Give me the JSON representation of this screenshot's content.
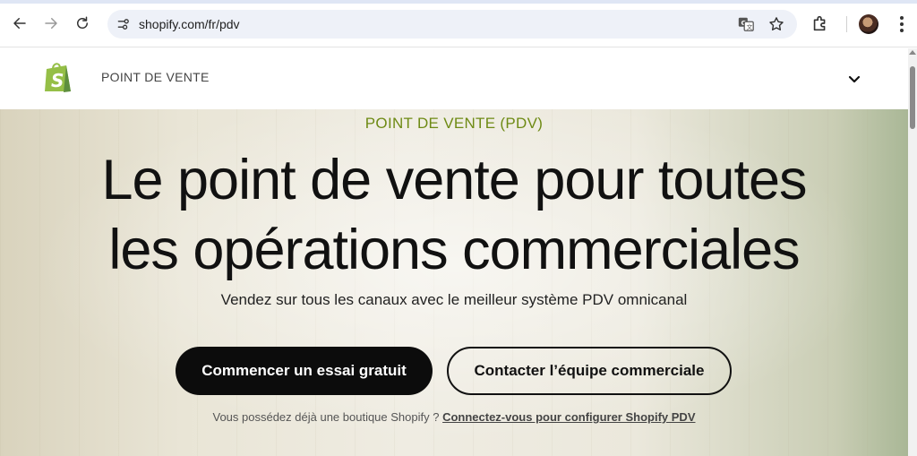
{
  "browser": {
    "url": "shopify.com/fr/pdv"
  },
  "header": {
    "title": "POINT DE VENTE"
  },
  "hero": {
    "eyebrow": "POINT DE VENTE (PDV)",
    "headline_line1": "Le point de vente pour toutes",
    "headline_line2": "les opérations commerciales",
    "subtitle": "Vendez sur tous les canaux avec le meilleur système PDV omnicanal",
    "primary_button": "Commencer un essai gratuit",
    "secondary_button": "Contacter l’équipe commerciale",
    "footnote_text": "Vous possédez déjà une boutique Shopify ? ",
    "footnote_link": "Connectez-vous pour configurer Shopify PDV"
  },
  "colors": {
    "brand_green": "#95bf47",
    "eyebrow": "#6e8a14",
    "button_dark": "#0c0c0c"
  },
  "icons": [
    "back-icon",
    "forward-icon",
    "reload-icon",
    "site-info-icon",
    "translate-icon",
    "star-icon",
    "extensions-icon",
    "menu-icon",
    "chevron-down-icon",
    "shopify-logo"
  ]
}
